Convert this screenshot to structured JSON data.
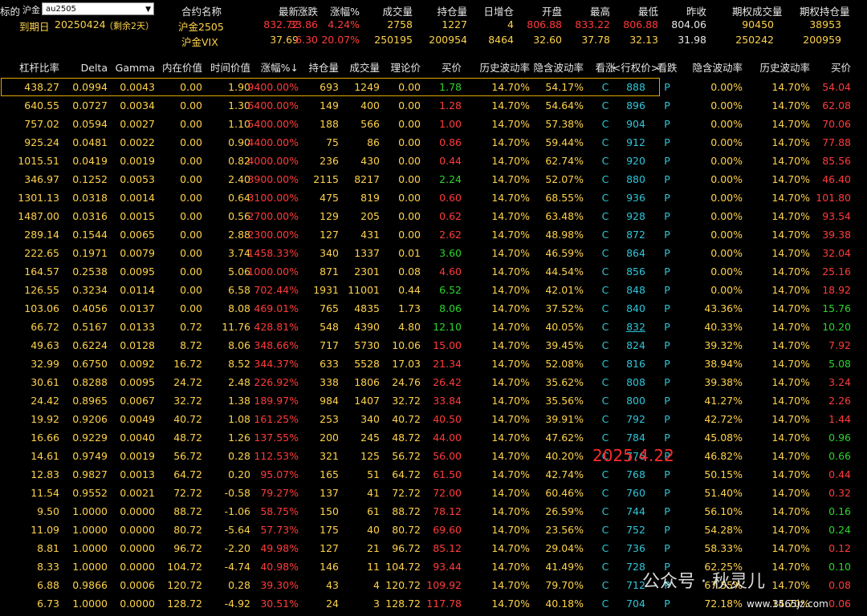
{
  "top": {
    "label_left": "标的",
    "underlying_label": "沪金",
    "select_value": "au2505",
    "expiry_label": "到期日",
    "expiry_value": "20250424",
    "expiry_remain": "（剩余2天）",
    "cols": [
      "合约名称",
      "最新",
      "涨跌",
      "涨幅%",
      "成交量",
      "持仓量",
      "日增仓",
      "开盘",
      "最高",
      "最低",
      "昨收",
      "期权成交量",
      "期权持仓量"
    ],
    "row1": [
      "沪金2505",
      "832.72",
      "33.86",
      "4.24%",
      "2758",
      "1227",
      "4",
      "806.88",
      "833.22",
      "806.88",
      "804.06",
      "90450",
      "38953"
    ],
    "row2": [
      "沪金VIX",
      "37.69",
      "6.30",
      "20.07%",
      "250195",
      "200954",
      "8464",
      "32.60",
      "37.78",
      "32.13",
      "31.98",
      "250242",
      "200959"
    ]
  },
  "header": [
    "杠杆比率",
    "Delta",
    "Gamma",
    "内在价值",
    "时间价值",
    "涨幅%",
    "持仓量",
    "成交量",
    "理论价",
    "买价",
    "历史波动率",
    "隐含波动率",
    "看涨",
    "<行权价>",
    "看跌",
    "隐含波动率",
    "历史波动率",
    "买价"
  ],
  "sort_arrow": "↓",
  "rows": [
    [
      "438.27",
      "0.0994",
      "0.0043",
      "0.00",
      "1.90",
      "9400.00%",
      "693",
      "1249",
      "0.00",
      "1.78",
      "14.70%",
      "54.17%",
      "C",
      "888",
      "P",
      "0.00%",
      "14.70%",
      "54.04"
    ],
    [
      "640.55",
      "0.0727",
      "0.0034",
      "0.00",
      "1.30",
      "6400.00%",
      "149",
      "400",
      "0.00",
      "1.28",
      "14.70%",
      "54.64%",
      "C",
      "896",
      "P",
      "0.00%",
      "14.70%",
      "62.08"
    ],
    [
      "757.02",
      "0.0594",
      "0.0027",
      "0.00",
      "1.10",
      "5400.00%",
      "188",
      "566",
      "0.00",
      "1.00",
      "14.70%",
      "57.38%",
      "C",
      "904",
      "P",
      "0.00%",
      "14.70%",
      "70.06"
    ],
    [
      "925.24",
      "0.0481",
      "0.0022",
      "0.00",
      "0.90",
      "4400.00%",
      "75",
      "86",
      "0.00",
      "0.86",
      "14.70%",
      "59.44%",
      "C",
      "912",
      "P",
      "0.00%",
      "14.70%",
      "77.88"
    ],
    [
      "1015.51",
      "0.0419",
      "0.0019",
      "0.00",
      "0.82",
      "4000.00%",
      "236",
      "430",
      "0.00",
      "0.44",
      "14.70%",
      "62.74%",
      "C",
      "920",
      "P",
      "0.00%",
      "14.70%",
      "85.56"
    ],
    [
      "346.97",
      "0.1252",
      "0.0053",
      "0.00",
      "2.40",
      "3900.00%",
      "2115",
      "8217",
      "0.00",
      "2.24",
      "14.70%",
      "52.07%",
      "C",
      "880",
      "P",
      "0.00%",
      "14.70%",
      "46.40"
    ],
    [
      "1301.13",
      "0.0318",
      "0.0014",
      "0.00",
      "0.64",
      "3100.00%",
      "475",
      "819",
      "0.00",
      "0.60",
      "14.70%",
      "68.55%",
      "C",
      "936",
      "P",
      "0.00%",
      "14.70%",
      "101.80"
    ],
    [
      "1487.00",
      "0.0316",
      "0.0015",
      "0.00",
      "0.56",
      "2700.00%",
      "129",
      "205",
      "0.00",
      "0.62",
      "14.70%",
      "63.48%",
      "C",
      "928",
      "P",
      "0.00%",
      "14.70%",
      "93.54"
    ],
    [
      "289.14",
      "0.1544",
      "0.0065",
      "0.00",
      "2.88",
      "2300.00%",
      "127",
      "431",
      "0.00",
      "2.62",
      "14.70%",
      "48.98%",
      "C",
      "872",
      "P",
      "0.00%",
      "14.70%",
      "39.38"
    ],
    [
      "222.65",
      "0.1971",
      "0.0079",
      "0.00",
      "3.74",
      "1458.33%",
      "340",
      "1337",
      "0.01",
      "3.60",
      "14.70%",
      "46.59%",
      "C",
      "864",
      "P",
      "0.00%",
      "14.70%",
      "32.04"
    ],
    [
      "164.57",
      "0.2538",
      "0.0095",
      "0.00",
      "5.06",
      "1000.00%",
      "871",
      "2301",
      "0.08",
      "4.60",
      "14.70%",
      "44.54%",
      "C",
      "856",
      "P",
      "0.00%",
      "14.70%",
      "25.16"
    ],
    [
      "126.55",
      "0.3234",
      "0.0114",
      "0.00",
      "6.58",
      "702.44%",
      "1931",
      "11001",
      "0.44",
      "6.52",
      "14.70%",
      "42.01%",
      "C",
      "848",
      "P",
      "0.00%",
      "14.70%",
      "18.92"
    ],
    [
      "103.06",
      "0.4056",
      "0.0137",
      "0.00",
      "8.08",
      "469.01%",
      "765",
      "4835",
      "1.73",
      "8.06",
      "14.70%",
      "37.52%",
      "C",
      "840",
      "P",
      "43.36%",
      "14.70%",
      "15.76"
    ],
    [
      "66.72",
      "0.5167",
      "0.0133",
      "0.72",
      "11.76",
      "428.81%",
      "548",
      "4390",
      "4.80",
      "12.10",
      "14.70%",
      "40.05%",
      "C",
      "832",
      "P",
      "40.33%",
      "14.70%",
      "10.20"
    ],
    [
      "49.63",
      "0.6224",
      "0.0128",
      "8.72",
      "8.06",
      "348.66%",
      "717",
      "5730",
      "10.06",
      "15.00",
      "14.70%",
      "39.45%",
      "C",
      "824",
      "P",
      "39.32%",
      "14.70%",
      "7.92"
    ],
    [
      "32.99",
      "0.6750",
      "0.0092",
      "16.72",
      "8.52",
      "344.37%",
      "633",
      "5528",
      "17.03",
      "21.34",
      "14.70%",
      "52.08%",
      "C",
      "816",
      "P",
      "38.94%",
      "14.70%",
      "5.08"
    ],
    [
      "30.61",
      "0.8288",
      "0.0095",
      "24.72",
      "2.48",
      "226.92%",
      "338",
      "1806",
      "24.76",
      "26.42",
      "14.70%",
      "35.62%",
      "C",
      "808",
      "P",
      "39.38%",
      "14.70%",
      "3.24"
    ],
    [
      "24.42",
      "0.8965",
      "0.0067",
      "32.72",
      "1.38",
      "189.97%",
      "984",
      "1407",
      "32.72",
      "33.84",
      "14.70%",
      "35.56%",
      "C",
      "800",
      "P",
      "41.27%",
      "14.70%",
      "2.26"
    ],
    [
      "19.92",
      "0.9206",
      "0.0049",
      "40.72",
      "1.08",
      "161.25%",
      "253",
      "340",
      "40.72",
      "40.50",
      "14.70%",
      "39.91%",
      "C",
      "792",
      "P",
      "42.72%",
      "14.70%",
      "1.44"
    ],
    [
      "16.66",
      "0.9229",
      "0.0040",
      "48.72",
      "1.26",
      "137.55%",
      "200",
      "245",
      "48.72",
      "44.00",
      "14.70%",
      "47.62%",
      "C",
      "784",
      "P",
      "45.08%",
      "14.70%",
      "0.96"
    ],
    [
      "14.61",
      "0.9749",
      "0.0019",
      "56.72",
      "0.28",
      "112.53%",
      "321",
      "125",
      "56.72",
      "56.00",
      "14.70%",
      "40.20%",
      "C",
      "776",
      "P",
      "46.82%",
      "14.70%",
      "0.66"
    ],
    [
      "12.83",
      "0.9827",
      "0.0013",
      "64.72",
      "0.20",
      "95.07%",
      "165",
      "51",
      "64.72",
      "61.50",
      "14.70%",
      "42.74%",
      "C",
      "768",
      "P",
      "50.15%",
      "14.70%",
      "0.44"
    ],
    [
      "11.54",
      "0.9552",
      "0.0021",
      "72.72",
      "-0.58",
      "79.27%",
      "137",
      "41",
      "72.72",
      "72.00",
      "14.70%",
      "60.46%",
      "C",
      "760",
      "P",
      "51.40%",
      "14.70%",
      "0.32"
    ],
    [
      "9.50",
      "1.0000",
      "0.0000",
      "88.72",
      "-1.06",
      "58.75%",
      "150",
      "61",
      "88.72",
      "78.12",
      "14.70%",
      "26.59%",
      "C",
      "744",
      "P",
      "56.10%",
      "14.70%",
      "0.16"
    ],
    [
      "11.09",
      "1.0000",
      "0.0000",
      "80.72",
      "-5.64",
      "57.73%",
      "175",
      "40",
      "80.72",
      "69.60",
      "14.70%",
      "23.56%",
      "C",
      "752",
      "P",
      "54.28%",
      "14.70%",
      "0.24"
    ],
    [
      "8.81",
      "1.0000",
      "0.0000",
      "96.72",
      "-2.20",
      "49.98%",
      "127",
      "21",
      "96.72",
      "85.12",
      "14.70%",
      "29.04%",
      "C",
      "736",
      "P",
      "58.33%",
      "14.70%",
      "0.12"
    ],
    [
      "8.33",
      "1.0000",
      "0.0000",
      "104.72",
      "-4.74",
      "40.98%",
      "146",
      "11",
      "104.72",
      "93.44",
      "14.70%",
      "41.49%",
      "C",
      "728",
      "P",
      "62.25%",
      "14.70%",
      "0.10"
    ],
    [
      "6.88",
      "0.9866",
      "0.0006",
      "120.72",
      "0.28",
      "39.30%",
      "43",
      "4",
      "120.72",
      "109.92",
      "14.70%",
      "79.70%",
      "C",
      "712",
      "P",
      "67.55%",
      "14.70%",
      "0.08"
    ],
    [
      "6.73",
      "1.0000",
      "0.0000",
      "128.72",
      "-4.92",
      "30.51%",
      "24",
      "3",
      "128.72",
      "117.78",
      "14.70%",
      "40.18%",
      "C",
      "704",
      "P",
      "72.18%",
      "14.70%",
      "0.06"
    ]
  ],
  "put_buy_colors": [
    "red",
    "red",
    "red",
    "red",
    "red",
    "red",
    "red",
    "red",
    "red",
    "red",
    "red",
    "red",
    "grn",
    "grn",
    "red",
    "grn",
    "red",
    "red",
    "red",
    "grn",
    "grn",
    "red",
    "red",
    "grn",
    "grn",
    "red",
    "grn",
    "red",
    "red"
  ],
  "call_buy_colors": [
    "grn",
    "red",
    "red",
    "red",
    "red",
    "grn",
    "red",
    "red",
    "red",
    "grn",
    "red",
    "grn",
    "grn",
    "grn",
    "red",
    "red",
    "red",
    "red",
    "red",
    "red",
    "red",
    "red",
    "red",
    "red",
    "red",
    "red",
    "red",
    "red",
    "red"
  ],
  "overlay": {
    "date": "2025.4.22",
    "watermark": "公众号 · 秋灵儿",
    "site": "www.3565jz.com"
  }
}
